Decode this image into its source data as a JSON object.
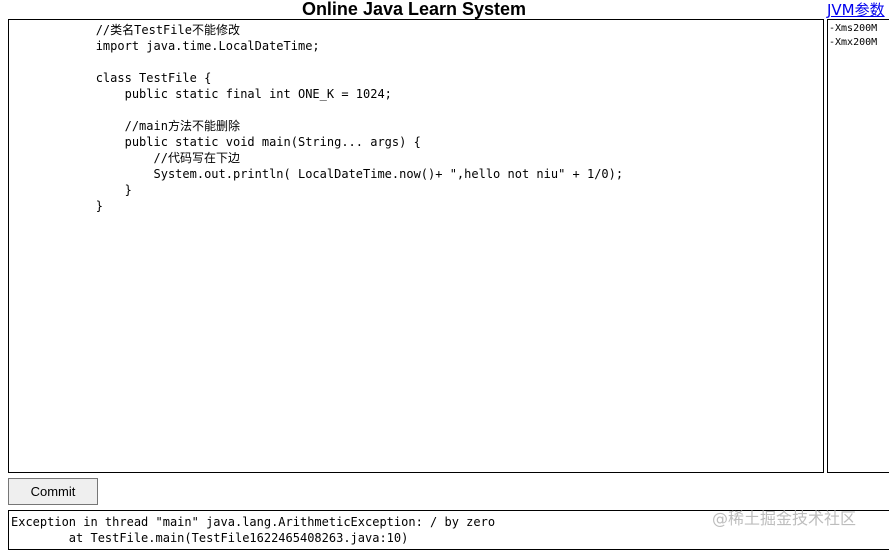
{
  "page": {
    "title": "Online Java Learn System",
    "jvm_link": "JVM参数"
  },
  "editor": {
    "code": "            //类名TestFile不能修改\n            import java.time.LocalDateTime;\n\n            class TestFile {\n                public static final int ONE_K = 1024;\n\n                //main方法不能删除\n                public static void main(String... args) {\n                    //代码写在下边\n                    System.out.println( LocalDateTime.now()+ \",hello not niu\" + 1/0);\n                }\n            }"
  },
  "jvm_params": {
    "value": "-Xms200M\n-Xmx200M"
  },
  "actions": {
    "commit_label": "Commit"
  },
  "output": {
    "text": "Exception in thread \"main\" java.lang.ArithmeticException: / by zero\n        at TestFile.main(TestFile1622465408263.java:10)"
  },
  "watermark": {
    "text": "@稀土掘金技术社区"
  }
}
